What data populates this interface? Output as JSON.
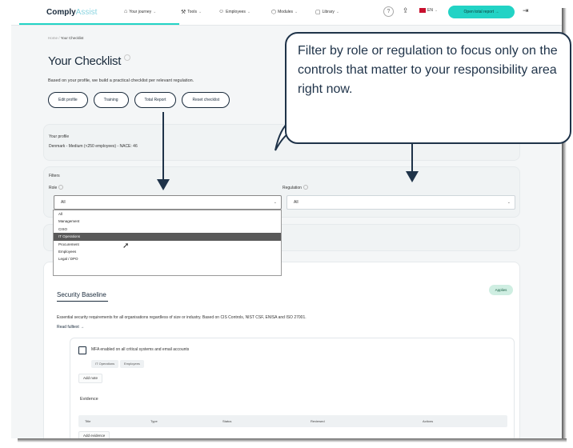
{
  "app": {
    "logo_main": "Comply",
    "logo_accent": "Assist"
  },
  "nav": {
    "items": [
      {
        "label": "Your journey",
        "icon": "home-icon"
      },
      {
        "label": "Tools",
        "icon": "wrench-icon"
      },
      {
        "label": "Employees",
        "icon": "users-icon"
      },
      {
        "label": "Modules",
        "icon": "shield-icon"
      },
      {
        "label": "Library",
        "icon": "book-icon"
      }
    ],
    "help": "?",
    "language": "EN",
    "cta": "Open total report →",
    "accent_color": "#22d3c5"
  },
  "breadcrumb": {
    "home": "Home",
    "separator": "/",
    "current": "Your Checklist"
  },
  "page": {
    "title": "Your Checklist",
    "subtitle": "Based on your profile, we build a practical checklist per relevant regulation.",
    "buttons": [
      "Edit profile",
      "Training",
      "Total Report",
      "Reset checklist"
    ]
  },
  "profile": {
    "label": "Your profile",
    "value": "Denmark - Medium (<250 employees) - NACE: 46"
  },
  "filters": {
    "heading": "Filters",
    "role_label": "Role",
    "role_value": "All",
    "regulation_label": "Regulation",
    "regulation_value": "All",
    "role_options": [
      "All",
      "Management",
      "CISO",
      "IT Operations",
      "Procurement",
      "Employees",
      "Legal / DPO"
    ],
    "highlighted_option": "IT Operations"
  },
  "baseline": {
    "title": "Security Baseline",
    "badge": "Applies",
    "description": "Essential security requirements for all organisations regardless of size or industry. Based on CIS Controls, NIST CSF, ENISA and ISO 27001.",
    "read_link": "Read fulltext →",
    "control": {
      "text": "MFA enabled on all critical systems and email accounts",
      "tags": [
        "IT Operations",
        "Employees"
      ],
      "add_note": "Add note"
    },
    "evidence": {
      "label": "Evidence",
      "columns": [
        "Title",
        "Type",
        "Status",
        "Reviewed",
        "Actions"
      ],
      "add_button": "Add evidence"
    }
  },
  "callout": {
    "text": "Filter by role or regulation to focus only on the controls that matter to your responsibility area right now."
  }
}
